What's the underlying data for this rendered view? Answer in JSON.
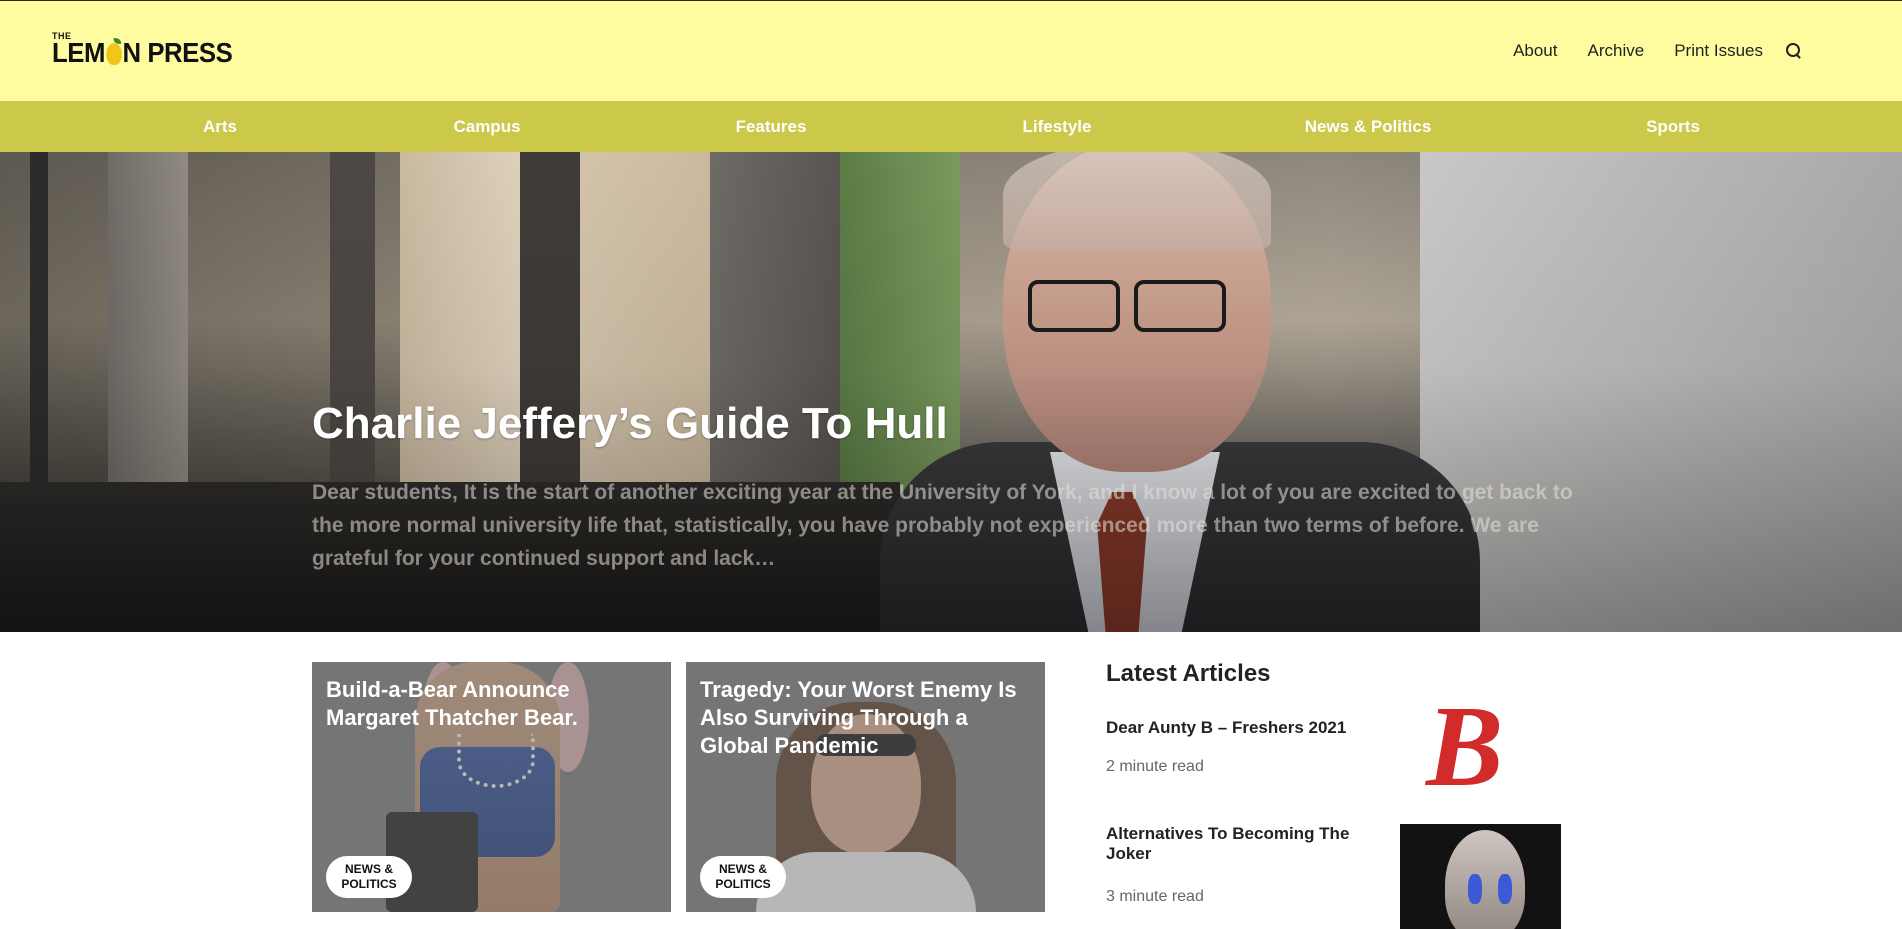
{
  "brand": {
    "the": "THE",
    "name_left": "LEM",
    "name_right": "N PRESS"
  },
  "topnav": {
    "about": "About",
    "archive": "Archive",
    "print_issues": "Print Issues"
  },
  "categories": [
    "Arts",
    "Campus",
    "Features",
    "Lifestyle",
    "News & Politics",
    "Sports"
  ],
  "hero": {
    "title": "Charlie Jeffery’s Guide To Hull",
    "excerpt": "Dear students, It is the start of another exciting year at the University of York, and I know a lot of you are excited to get back to the more normal university life that, statistically, you have probably not experienced more than two terms of before. We are grateful for your continued support and lack…"
  },
  "cards": [
    {
      "title": "Build-a-Bear Announce Margaret Thatcher Bear.",
      "tag": "NEWS & POLITICS"
    },
    {
      "title": "Tragedy: Your Worst Enemy Is Also Surviving Through a Global Pandemic",
      "tag": "NEWS & POLITICS"
    }
  ],
  "latest": {
    "heading": "Latest Articles",
    "items": [
      {
        "title": "Dear Aunty B – Freshers 2021",
        "read": "2 minute read",
        "thumb_icon": "aunty-b-logo"
      },
      {
        "title": "Alternatives To Becoming The Joker",
        "read": "3 minute read",
        "thumb_icon": "joker-photo"
      }
    ]
  },
  "colors": {
    "header_bg": "#fffca0",
    "category_bar": "#cbc84a",
    "lemon": "#f0c619"
  }
}
